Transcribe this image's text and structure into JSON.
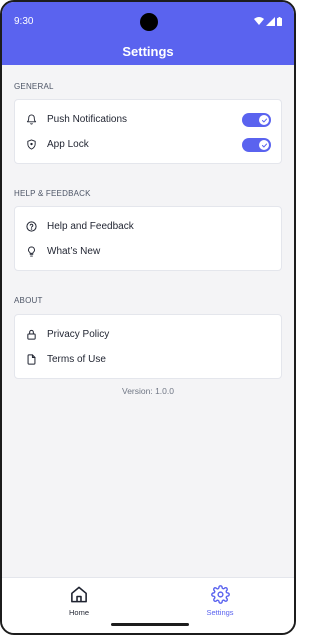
{
  "status_bar": {
    "time": "9:30",
    "icons": [
      "wifi-icon",
      "signal-icon",
      "battery-icon"
    ]
  },
  "app_bar": {
    "title": "Settings",
    "color": "#5a63ef"
  },
  "sections": [
    {
      "label": "GENERAL",
      "items": [
        {
          "label": "Push Notifications",
          "icon": "bell-icon",
          "toggle": true
        },
        {
          "label": "App Lock",
          "icon": "shield-icon",
          "toggle": true
        }
      ]
    },
    {
      "label": "HELP & FEEDBACK",
      "items": [
        {
          "label": "Help and Feedback",
          "icon": "help-circle-icon"
        },
        {
          "label": "What’s New",
          "icon": "lightbulb-icon"
        }
      ]
    },
    {
      "label": "ABOUT",
      "items": [
        {
          "label": "Privacy Policy",
          "icon": "lock-icon"
        },
        {
          "label": "Terms of Use",
          "icon": "document-icon"
        }
      ]
    }
  ],
  "version_text": "Version: 1.0.0",
  "bottom_nav": {
    "items": [
      {
        "label": "Home",
        "icon": "home-icon",
        "active": false
      },
      {
        "label": "Settings",
        "icon": "gear-icon",
        "active": true
      }
    ],
    "active_color": "#5a63ef"
  }
}
